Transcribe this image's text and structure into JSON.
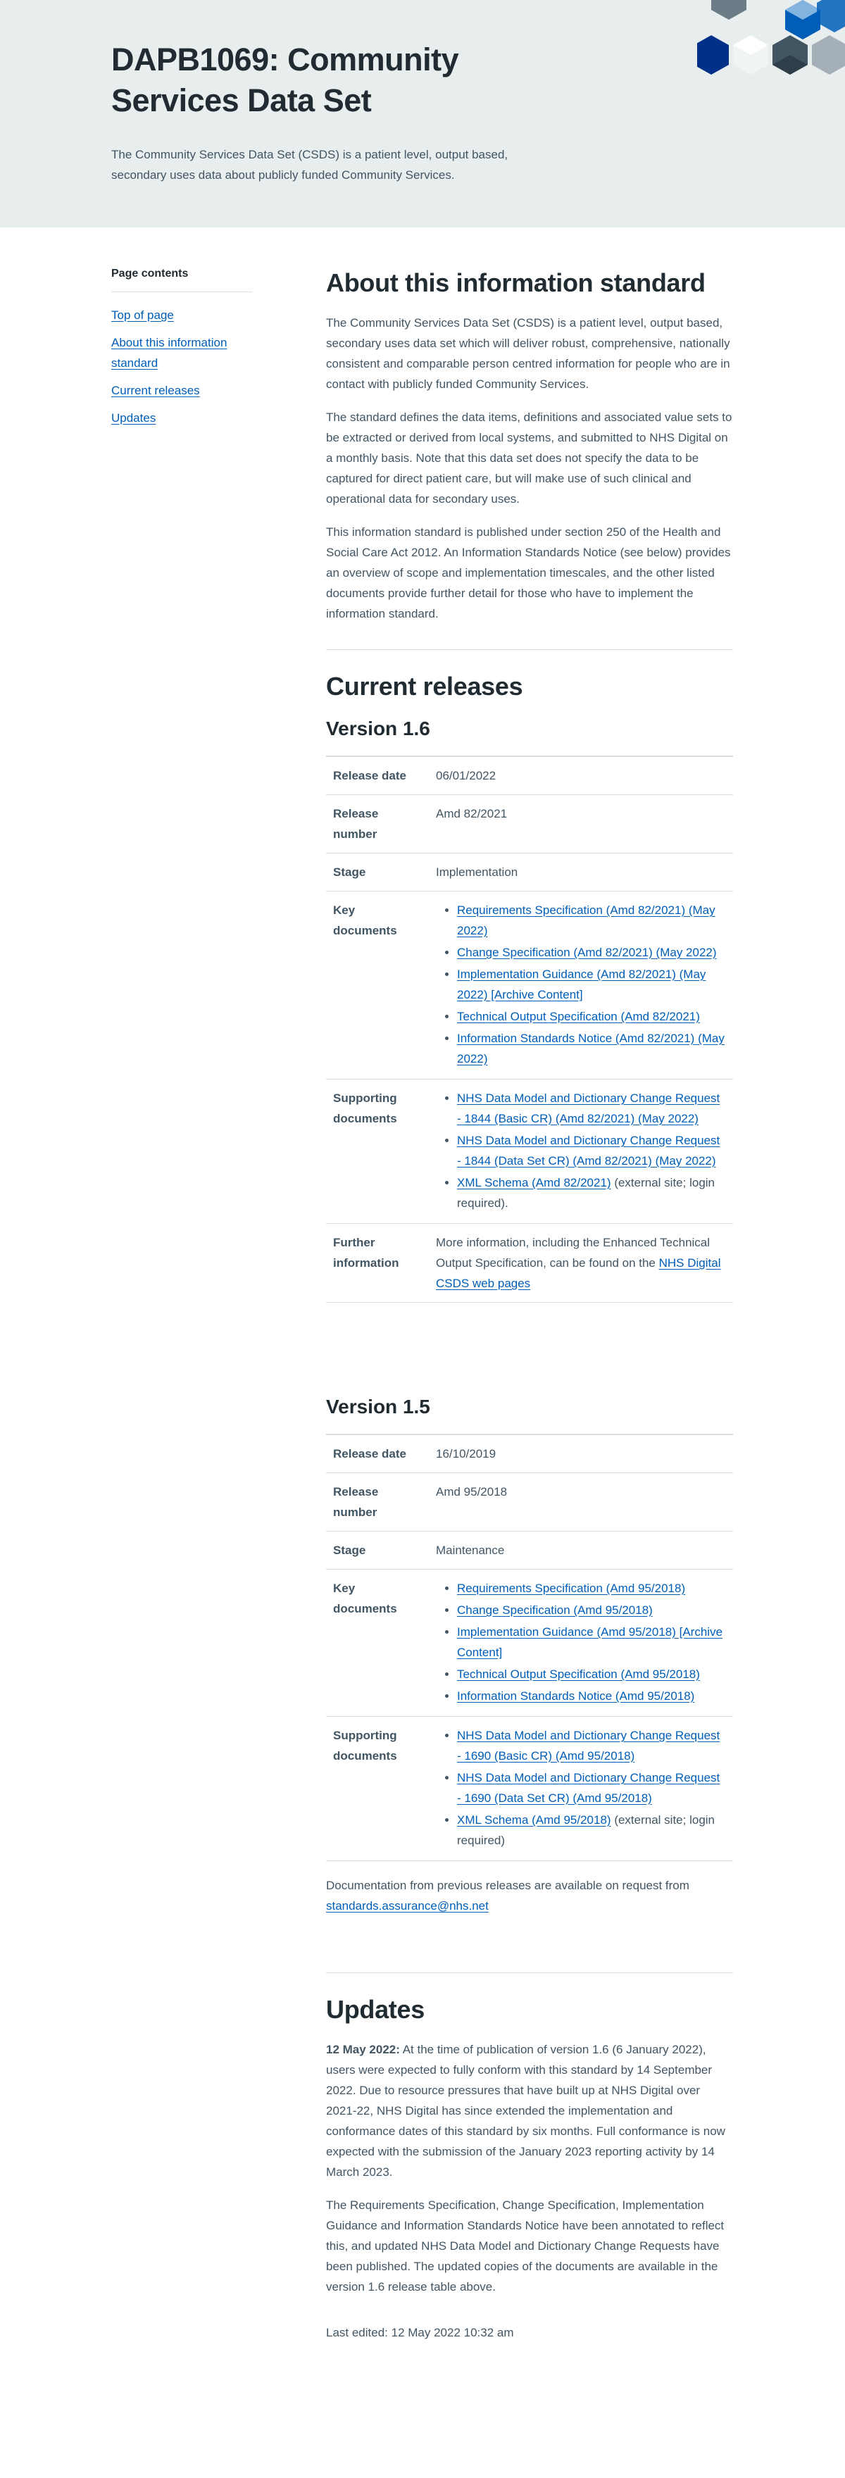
{
  "hero": {
    "title": "DAPB1069: Community Services Data Set",
    "lead": "The Community Services Data Set (CSDS) is a patient level, output based, secondary uses data about publicly funded Community Services."
  },
  "toc": {
    "title": "Page contents",
    "items": [
      "Top of page",
      "About this information standard",
      "Current releases",
      "Updates"
    ]
  },
  "about": {
    "heading": "About this information standard",
    "p1": "The Community Services Data Set (CSDS) is a patient level, output based, secondary uses data set which will deliver robust, comprehensive, nationally consistent and comparable person centred information for people who are in contact with publicly funded Community Services.",
    "p2": "The standard defines the data items, definitions and associated value sets to be extracted or derived from local systems, and submitted to NHS Digital on a monthly basis. Note that this data set does not specify the data to be captured for direct patient care, but will make use of such clinical and operational data for secondary uses.",
    "p3": "This information standard is published under section 250 of the Health and Social Care Act 2012. An Information Standards Notice (see below) provides an overview of scope and implementation timescales, and the other listed documents provide further detail for those who have to implement the information standard."
  },
  "releases": {
    "heading": "Current releases",
    "labels": {
      "release_date": "Release date",
      "release_number": "Release number",
      "stage": "Stage",
      "key_documents": "Key documents",
      "supporting_documents": "Supporting documents",
      "further_information": "Further information"
    },
    "v16": {
      "heading": "Version 1.6",
      "release_date": "06/01/2022",
      "release_number": "Amd 82/2021",
      "stage": "Implementation",
      "key_documents": [
        "Requirements Specification (Amd 82/2021) (May 2022)",
        "Change Specification (Amd 82/2021) (May 2022)",
        "Implementation Guidance (Amd 82/2021) (May 2022) [Archive Content]",
        "Technical Output Specification (Amd 82/2021)",
        "Information Standards Notice (Amd 82/2021) (May 2022)"
      ],
      "supporting_documents": [
        "NHS Data Model and Dictionary Change Request - 1844  (Basic CR) (Amd 82/2021) (May 2022)",
        "NHS Data Model and Dictionary Change Request - 1844 (Data Set CR) (Amd 82/2021) (May 2022)"
      ],
      "xml_link": "XML Schema (Amd 82/2021)",
      "xml_note": " (external site; login required).",
      "further_text": "More information, including the Enhanced Technical Output Specification, can be found on the ",
      "further_link": "NHS Digital CSDS web pages"
    },
    "v15": {
      "heading": "Version 1.5",
      "release_date": "16/10/2019",
      "release_number": "Amd 95/2018",
      "stage": "Maintenance",
      "key_documents": [
        "Requirements Specification (Amd 95/2018)",
        "Change Specification (Amd 95/2018)",
        "Implementation Guidance (Amd 95/2018) [Archive Content]",
        "Technical Output Specification (Amd 95/2018)",
        "Information Standards Notice (Amd 95/2018)"
      ],
      "supporting_documents": [
        "NHS Data Model and Dictionary Change Request - 1690 (Basic CR) (Amd 95/2018)",
        "NHS Data Model and Dictionary Change Request - 1690 (Data Set CR) (Amd 95/2018)"
      ],
      "xml_link": "XML Schema (Amd 95/2018)",
      "xml_note": " (external site; login required)"
    },
    "previous_text": "Documentation from previous releases are available on request from ",
    "previous_email": "standards.assurance@nhs.net"
  },
  "updates": {
    "heading": "Updates",
    "date": "12 May 2022:",
    "p1": "  At the time of publication of version 1.6 (6 January 2022), users were expected to fully conform with this standard by 14 September 2022. Due to resource pressures that have built up at NHS Digital over 2021-22, NHS Digital has since extended the implementation and conformance dates of this standard by six months. Full conformance is now expected with the submission of the January 2023 reporting activity by 14 March 2023.",
    "p2": "The Requirements Specification, Change Specification, Implementation Guidance and Information Standards Notice have been annotated to reflect this, and updated NHS Data Model and Dictionary Change Requests have been published.  The updated copies of the documents are available in the version 1.6 release table above.",
    "last_edited": "Last edited: 12 May 2022 10:32 am"
  },
  "colors": {
    "hero_bg": "#e8edee",
    "link": "#005eb8",
    "text": "#425563",
    "heading": "#212b32",
    "hex_dark_blue": "#003087",
    "hex_mid_blue": "#005eb8",
    "hex_light_blue": "#a4c8e8",
    "hex_grey": "#425563"
  }
}
